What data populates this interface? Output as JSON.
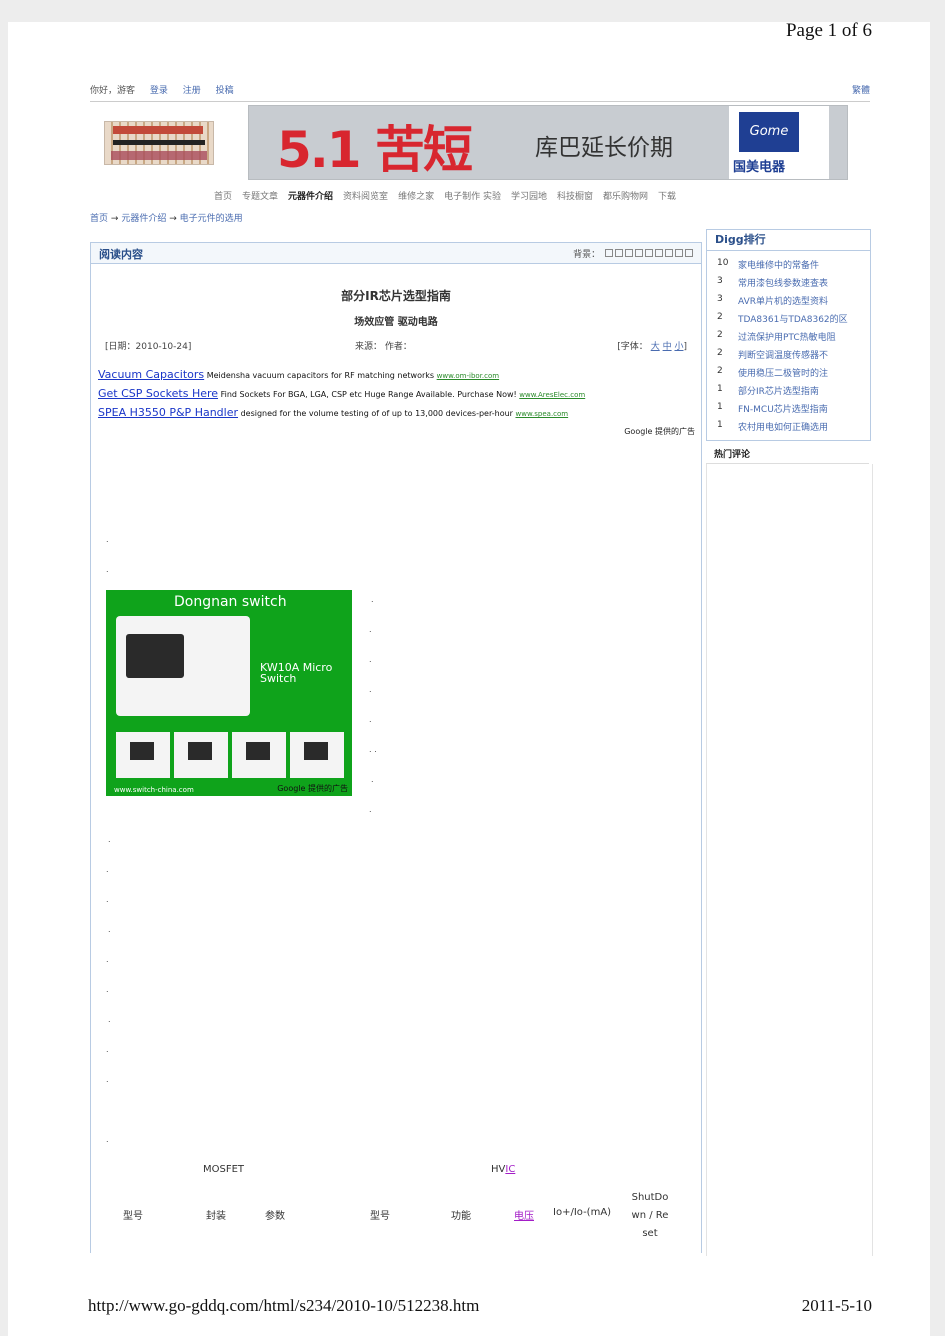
{
  "pager": "Page 1 of 6",
  "top_bar": {
    "greeting": "你好，游客",
    "login": "登录",
    "register": "注册",
    "submit": "投稿",
    "traditional": "繁體"
  },
  "banner": {
    "headline": "5.1 苦短",
    "slogan": "库巴延长价期",
    "gome_logo": "Gome",
    "gome_cn": "国美电器"
  },
  "nav": [
    "首页",
    "专题文章",
    "元器件介绍",
    "资料阅览室",
    "维修之家",
    "电子制作 实验",
    "学习园地",
    "科技橱窗",
    "都乐购物网",
    "下载"
  ],
  "nav_active_index": 2,
  "breadcrumb": [
    "首页",
    "元器件介绍",
    "电子元件的选用"
  ],
  "breadcrumb_sep": "→",
  "article": {
    "panel_title": "阅读内容",
    "bg_label": "背景：",
    "title": "部分IR芯片选型指南",
    "subtitle": "场效应管 驱动电路",
    "date": "[日期：2010-10-24]",
    "source": "来源：   作者：",
    "font_label": "[字体：",
    "font_big": "大",
    "font_mid": "中",
    "font_small": "小",
    "font_close": "]"
  },
  "ads": [
    {
      "headline": "Vacuum Capacitors",
      "text": "Meidensha vacuum capacitors for RF matching networks",
      "url": "www.om-ibor.com"
    },
    {
      "headline": "Get CSP Sockets Here",
      "text": "Find Sockets For BGA, LGA, CSP etc Huge Range Available. Purchase Now!",
      "url": "www.AresElec.com"
    },
    {
      "headline": "SPEA H3550 P&P Handler",
      "text": "designed for the volume testing of of up to 13,000 devices-per-hour",
      "url": "www.spea.com"
    }
  ],
  "google_ads_label": "Google 提供的广告",
  "switch_ad": {
    "header": "Dongnan switch",
    "model": "KW10A  Micro Switch",
    "url": "www.switch-china.com",
    "google": "Google 提供的广告"
  },
  "table": {
    "group_left": "MOSFET",
    "group_right_prefix": "HV",
    "group_right_link": "IC",
    "columns": [
      "型号",
      "封装",
      "参数",
      "型号",
      "功能",
      "电压",
      "Io+/Io-(mA)",
      "ShutDo wn / Re set"
    ]
  },
  "sidebar": {
    "title": "Digg排行",
    "items": [
      {
        "count": "10",
        "title": "家电维修中的常备件"
      },
      {
        "count": "3",
        "title": "常用漆包线参数速查表"
      },
      {
        "count": "3",
        "title": "AVR单片机的选型资料"
      },
      {
        "count": "2",
        "title": "TDA8361与TDA8362的区"
      },
      {
        "count": "2",
        "title": "过流保护用PTC热敏电阻"
      },
      {
        "count": "2",
        "title": "判断空调温度传感器不"
      },
      {
        "count": "2",
        "title": "使用稳压二极管时的注"
      },
      {
        "count": "1",
        "title": "部分IR芯片选型指南"
      },
      {
        "count": "1",
        "title": "FN-MCU芯片选型指南"
      },
      {
        "count": "1",
        "title": "农村用电如何正确选用"
      }
    ],
    "hot_title": "热门评论"
  },
  "footer": {
    "url": "http://www.go-gddq.com/html/s234/2010-10/512238.htm",
    "date": "2011-5-10"
  }
}
